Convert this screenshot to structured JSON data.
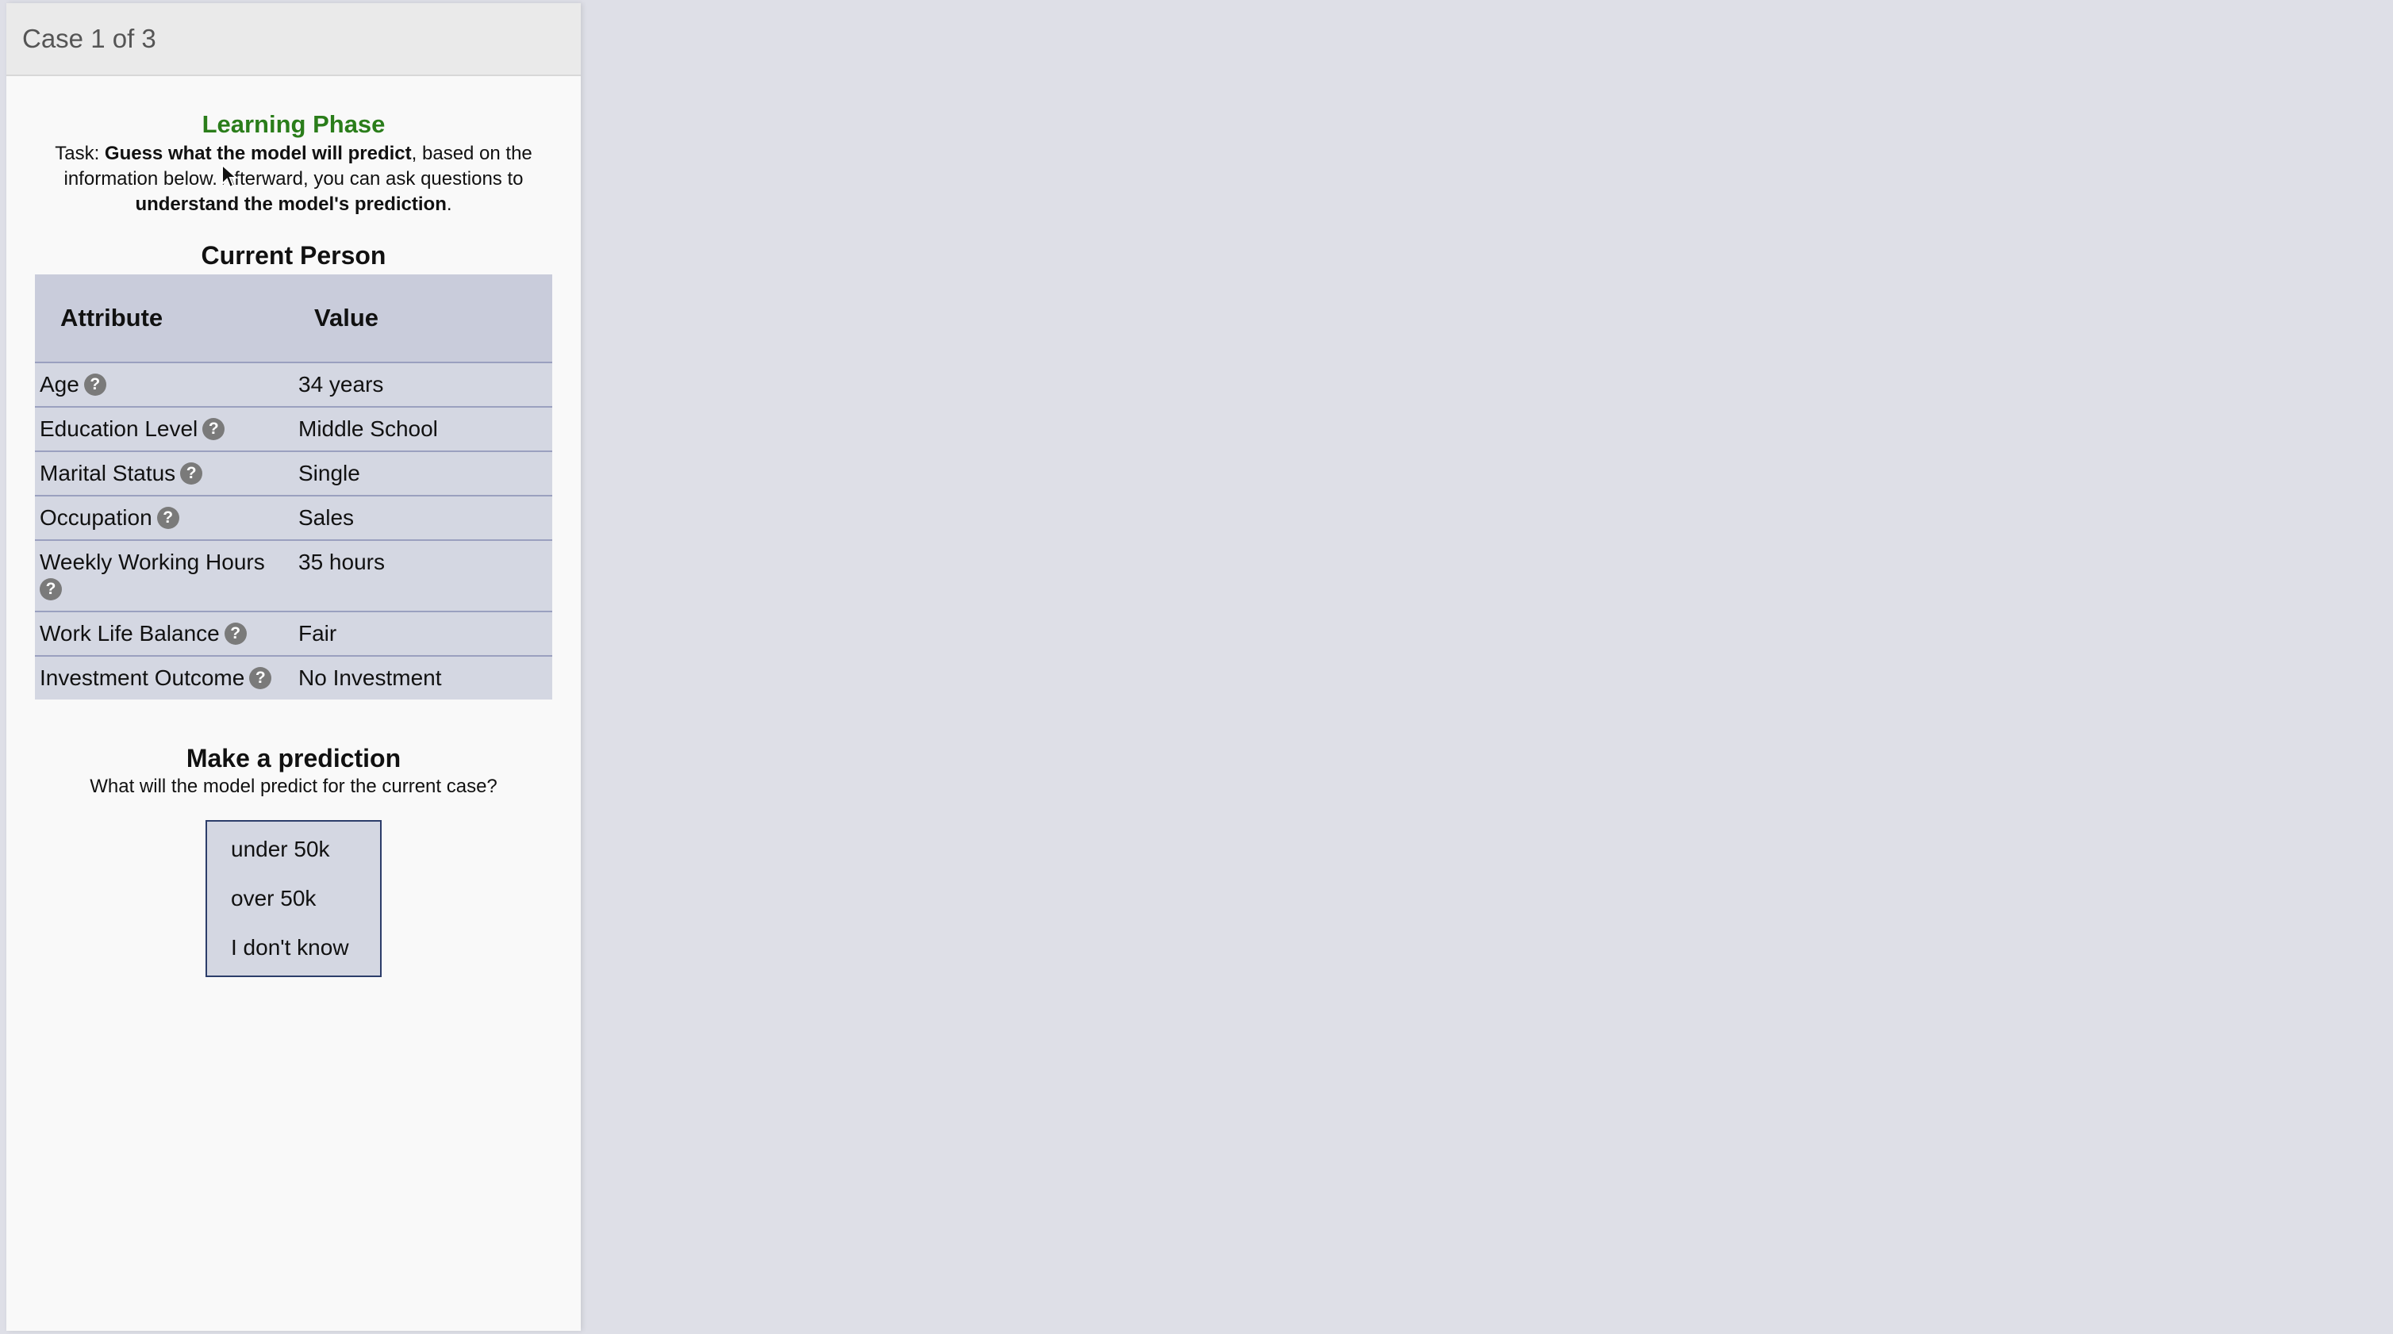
{
  "header": {
    "case_label": "Case 1 of 3"
  },
  "phase": {
    "title": "Learning Phase",
    "task_prefix": "Task: ",
    "task_bold1": "Guess what the model will predict",
    "task_mid": ", based on the information below. Afterward, you can ask questions to ",
    "task_bold2": "understand the model's prediction",
    "task_end": "."
  },
  "person": {
    "title": "Current Person",
    "columns": [
      "Attribute",
      "Value"
    ],
    "rows": [
      {
        "attribute": "Age",
        "value": "34 years"
      },
      {
        "attribute": "Education Level",
        "value": "Middle School"
      },
      {
        "attribute": "Marital Status",
        "value": "Single"
      },
      {
        "attribute": "Occupation",
        "value": "Sales"
      },
      {
        "attribute": "Weekly Working Hours",
        "value": "35 hours"
      },
      {
        "attribute": "Work Life Balance",
        "value": "Fair"
      },
      {
        "attribute": "Investment Outcome",
        "value": "No Investment"
      }
    ],
    "help_icon_glyph": "?"
  },
  "prediction": {
    "title": "Make a prediction",
    "question": "What will the model predict for the current case?",
    "options": [
      "under 50k",
      "over 50k",
      "I don't know"
    ]
  },
  "colors": {
    "phase_title": "#2a7d1a",
    "table_bg": "#d4d7e2",
    "options_border": "#2c3d6a",
    "page_bg": "#dedfe7"
  }
}
